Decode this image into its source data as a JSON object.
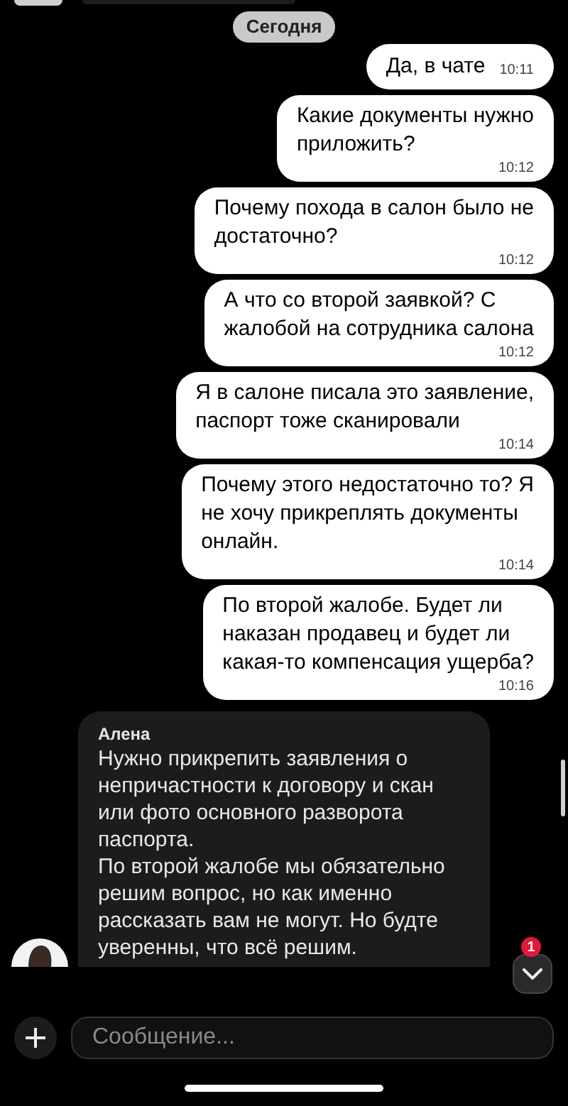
{
  "date_divider": "Сегодня",
  "messages": [
    {
      "kind": "outgoing",
      "text": "Да, в чате",
      "time": "10:11"
    },
    {
      "kind": "outgoing",
      "text": "Какие документы нужно\nприложить?",
      "time": "10:12"
    },
    {
      "kind": "outgoing",
      "text": "Почему похода в салон было не\nдостаточно?",
      "time": "10:12"
    },
    {
      "kind": "outgoing",
      "text": "А что со второй заявкой? С\nжалобой на сотрудника салона",
      "time": "10:12"
    },
    {
      "kind": "outgoing",
      "text": "Я в салоне писала это заявление,\nпаспорт тоже сканировали",
      "time": "10:14"
    },
    {
      "kind": "outgoing",
      "text": "Почему этого недостаточно то? Я\nне хочу прикреплять документы\nонлайн.",
      "time": "10:14"
    },
    {
      "kind": "outgoing",
      "text": "По второй жалобе. Будет ли\nнаказан продавец и будет ли\nкакая-то компенсация ущерба?",
      "time": "10:16"
    },
    {
      "kind": "incoming",
      "sender": "Алена",
      "text": "Нужно прикрепить заявления о\nнепричастности к договору и скан\nили фото основного разворота\nпаспорта.\nПо второй жалобе мы обязательно\nрешим вопрос, но как именно\nрассказать вам не могут. Но будте\nуверенны, что всё решим."
    }
  ],
  "scroll_down_badge": "1",
  "composer": {
    "placeholder": "Сообщение..."
  }
}
